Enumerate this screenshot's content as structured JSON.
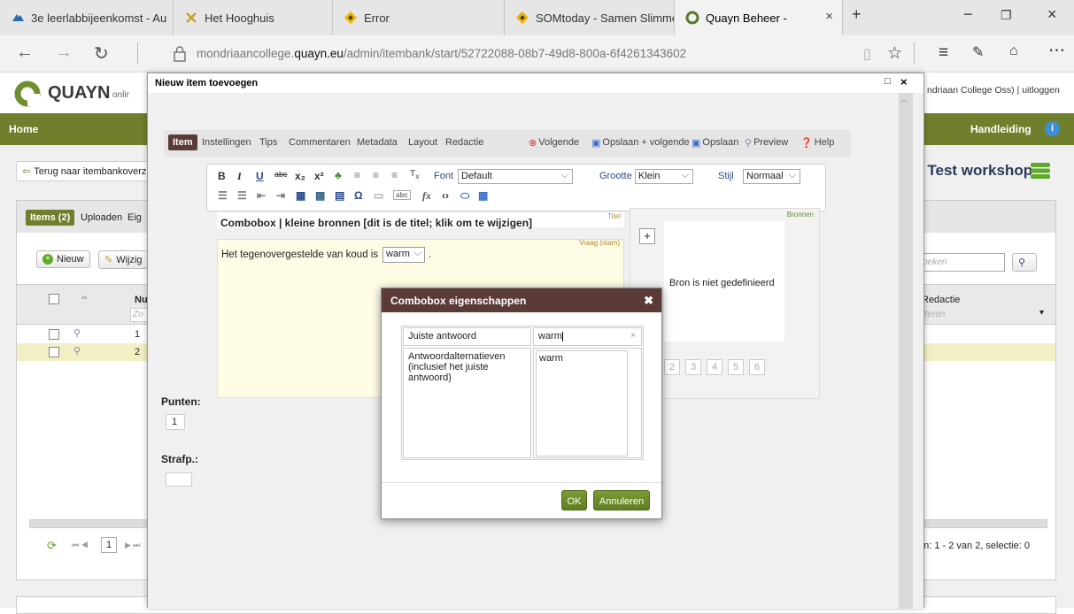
{
  "browser": {
    "tabs": [
      {
        "label": "3e leerlabbijeenkomst - Au",
        "icon": "cloud-icon"
      },
      {
        "label": "Het Hooghuis",
        "icon": "x-logo-icon"
      },
      {
        "label": "Error",
        "icon": "diamond-icon"
      },
      {
        "label": "SOMtoday - Samen Slimme",
        "icon": "diamond-icon"
      },
      {
        "label": "Quayn Beheer -",
        "icon": "quayn-icon",
        "active": true
      }
    ],
    "url_prefix": "mondriaancollege.",
    "url_host": "quayn.eu",
    "url_path": "/admin/itembank/start/52722088-08b7-49d8-800a-6f4261343602"
  },
  "app": {
    "logo_text": "QUAYN",
    "logo_sub": "onlir",
    "user_text": "ndriaan College Oss) | uitloggen",
    "nav_home": "Home",
    "nav_manual": "Handleiding",
    "back_link": "Terug naar itembankoverz",
    "workshop_title": ": Test workshop",
    "tabs": [
      "Items (2)",
      "Uploaden",
      "Eig"
    ],
    "btn_new": "Nieuw",
    "btn_edit": "Wijzig",
    "col_nr": "Nu",
    "col_nr_filter": "Zo",
    "row_numbers": [
      "1",
      "2"
    ],
    "col_redactie": "Redactie",
    "filter_placeholder": "Filteren",
    "search_placeholder": "Zoeken",
    "pager_page": "1",
    "pager_status": "en: 1 - 2 van 2,  selectie: 0"
  },
  "modal": {
    "title": "Nieuw item toevoegen",
    "tabs": [
      "Item",
      "Instellingen",
      "Tips",
      "Commentaren",
      "Metadata",
      "Layout",
      "Redactie"
    ],
    "actions": {
      "next": "Volgende",
      "save_next": "Opslaan + volgende",
      "save": "Opslaan",
      "preview": "Preview",
      "help": "Help"
    },
    "editor": {
      "font_label": "Font",
      "font_value": "Default",
      "size_label": "Grootte",
      "size_value": "Klein",
      "style_label": "Stijl",
      "style_value": "Normaal"
    },
    "title_label": "Titel",
    "item_title": "Combobox | kleine bronnen [dit is de titel; klik om te wijzigen]",
    "question_label": "Vraag (stam)",
    "question_text": "Het tegenovergestelde van koud is",
    "combo_value": "warm",
    "sources_label": "Bronnen",
    "source_empty": "Bron is niet gedefinieerd",
    "source_pages": [
      "2",
      "3",
      "4",
      "5",
      "6"
    ],
    "points_label": "Punten:",
    "points_value": "1",
    "penalty_label": "Strafp.:"
  },
  "dialog": {
    "title": "Combobox eigenschappen",
    "correct_label": "Juiste antwoord",
    "correct_value": "warm",
    "alternatives_label": "Antwoordalternatieven (inclusief het juiste antwoord)",
    "alternatives_value": "warm",
    "ok": "OK",
    "cancel": "Annuleren"
  }
}
